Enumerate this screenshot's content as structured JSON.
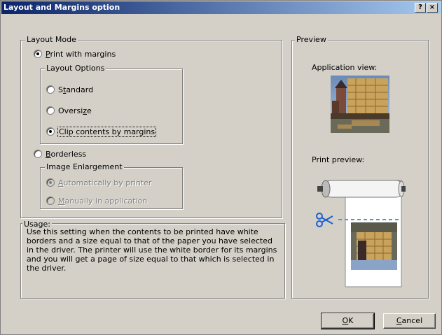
{
  "dialog": {
    "title": "Layout and Margins option",
    "help_button": "?",
    "close_button": "×"
  },
  "layout_mode": {
    "legend": "Layout Mode",
    "print_with_margins": {
      "label_prefix": "",
      "label_mnemonic": "P",
      "label_rest": "rint with margins",
      "checked": true
    },
    "layout_options": {
      "legend": "Layout Options",
      "standard": {
        "label_prefix": "S",
        "label_mnemonic": "t",
        "label_rest": "andard",
        "checked": false
      },
      "oversize": {
        "label_prefix": "Oversi",
        "label_mnemonic": "z",
        "label_rest": "e",
        "checked": false
      },
      "clip": {
        "label": "Clip contents by margins",
        "checked": true
      }
    },
    "borderless": {
      "label_prefix": "",
      "label_mnemonic": "B",
      "label_rest": "orderless",
      "checked": false
    },
    "image_enlargement": {
      "legend": "Image Enlargement",
      "automatically": {
        "label_prefix": "",
        "label_mnemonic": "A",
        "label_rest": "utomatically by printer",
        "checked": true,
        "disabled": true
      },
      "manually": {
        "label_prefix": "",
        "label_mnemonic": "M",
        "label_rest": "anually in application",
        "checked": false,
        "disabled": true
      }
    }
  },
  "usage": {
    "legend": "Usage:",
    "text": "Use this setting when the contents to be printed have white borders and a size equal to that of the paper you have selected in the driver. The printer will use the white border for its margins and you will get a page of size equal to that which is selected in the driver."
  },
  "preview": {
    "legend": "Preview",
    "application_view_label": "Application view:",
    "print_preview_label": "Print preview:"
  },
  "buttons": {
    "ok_prefix": "",
    "ok_mnemonic": "O",
    "ok_rest": "K",
    "cancel_prefix": "",
    "cancel_mnemonic": "C",
    "cancel_rest": "ancel"
  },
  "colors": {
    "title_start": "#0a246a",
    "title_end": "#a6caf0",
    "dialog_bg": "#d4d0c8",
    "scissors": "#1a5fd0",
    "cut_line": "#3aa0c8"
  },
  "icons": [
    "help-icon",
    "close-icon",
    "scissors-icon",
    "paper-roll-icon"
  ]
}
